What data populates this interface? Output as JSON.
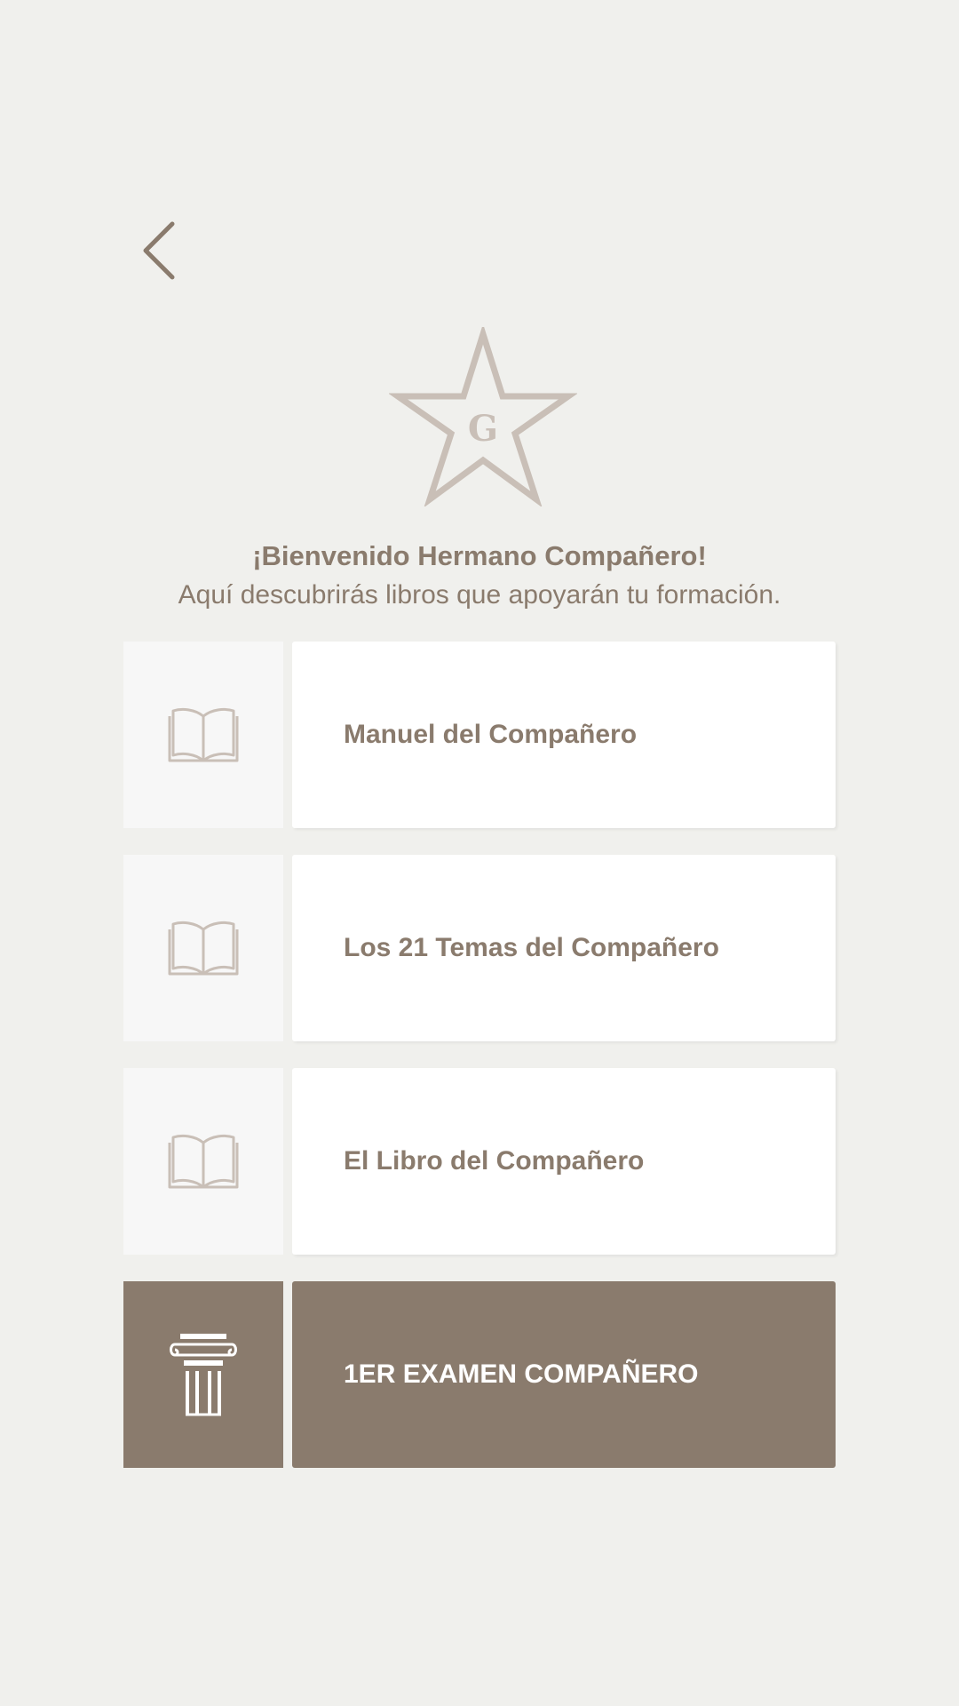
{
  "header": {
    "back_icon": "chevron-left-icon",
    "logo_icon": "star-g-icon",
    "logo_letter": "G"
  },
  "welcome": {
    "title": "¡Bienvenido Hermano Compañero!",
    "subtitle": "Aquí descubrirás libros que apoyarán tu formación."
  },
  "menu": {
    "items": [
      {
        "label": "Manuel del Compañero",
        "icon": "book-icon"
      },
      {
        "label": "Los 21 Temas del Compañero",
        "icon": "book-icon"
      },
      {
        "label": "El Libro del Compañero",
        "icon": "book-icon"
      },
      {
        "label": "1ER EXAMEN COMPAÑERO",
        "icon": "column-icon"
      }
    ]
  },
  "colors": {
    "background": "#f0f0ed",
    "accent": "#8a7b6d",
    "icon_light": "#c9bfb7",
    "card": "#ffffff"
  }
}
